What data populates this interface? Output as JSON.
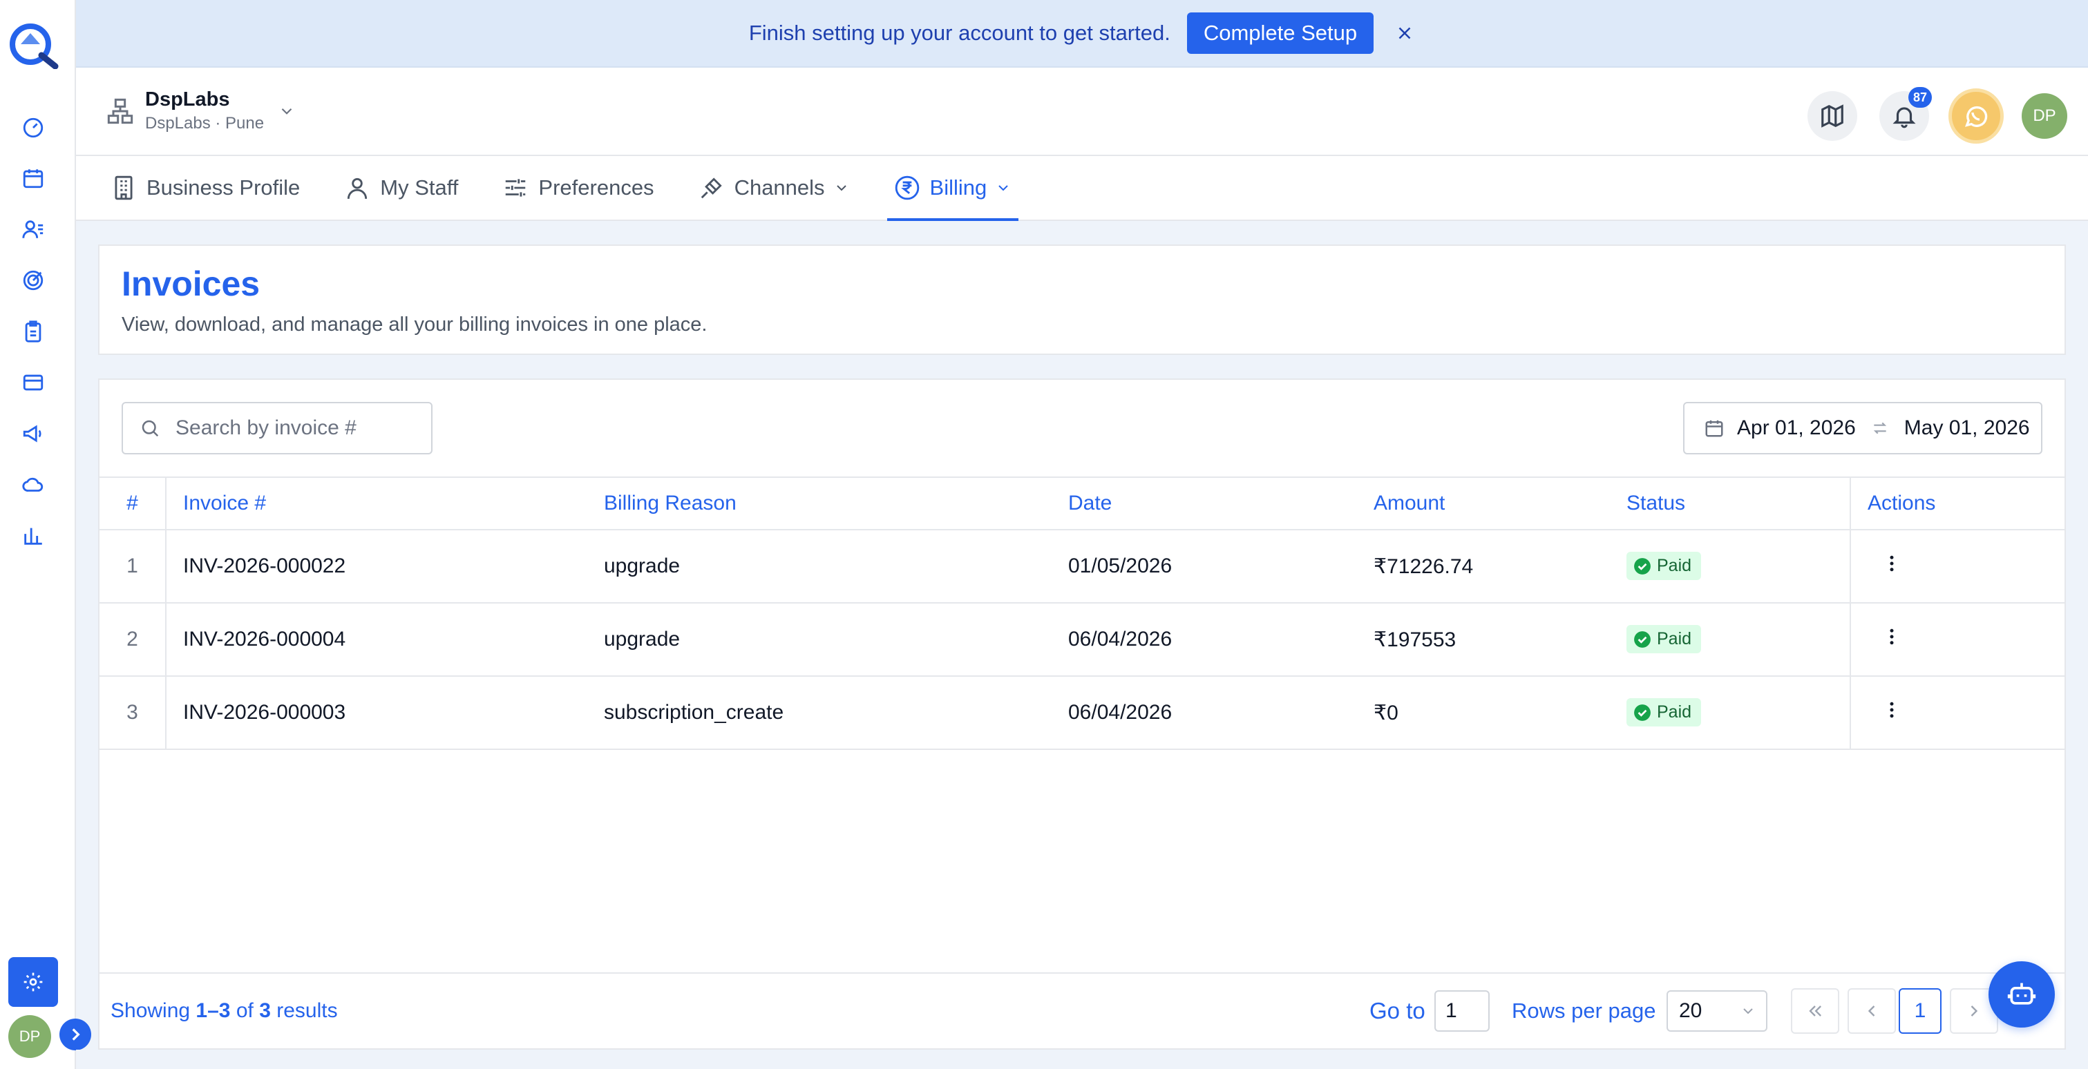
{
  "banner": {
    "message": "Finish setting up your account to get started.",
    "cta_label": "Complete Setup"
  },
  "org": {
    "name": "DspLabs",
    "subtitle": "DspLabs · Pune"
  },
  "header_actions": {
    "notification_count": "87",
    "avatar_initials": "DP"
  },
  "tabs": [
    {
      "label": "Business Profile"
    },
    {
      "label": "My Staff"
    },
    {
      "label": "Preferences"
    },
    {
      "label": "Channels"
    },
    {
      "label": "Billing"
    }
  ],
  "page": {
    "title": "Invoices",
    "subtitle": "View, download, and manage all your billing invoices in one place."
  },
  "search": {
    "placeholder": "Search by invoice #",
    "value": ""
  },
  "date_range": {
    "from": "Apr 01, 2026",
    "to": "May 01, 2026"
  },
  "table": {
    "columns": [
      "#",
      "Invoice #",
      "Billing Reason",
      "Date",
      "Amount",
      "Status",
      "Actions"
    ],
    "rows": [
      {
        "idx": "1",
        "invoice": "INV-2026-000022",
        "reason": "upgrade",
        "date": "01/05/2026",
        "amount": "₹71226.74",
        "status": "Paid"
      },
      {
        "idx": "2",
        "invoice": "INV-2026-000004",
        "reason": "upgrade",
        "date": "06/04/2026",
        "amount": "₹197553",
        "status": "Paid"
      },
      {
        "idx": "3",
        "invoice": "INV-2026-000003",
        "reason": "subscription_create",
        "date": "06/04/2026",
        "amount": "₹0",
        "status": "Paid"
      }
    ]
  },
  "pagination": {
    "showing_prefix": "Showing",
    "showing_range": "1–3",
    "showing_of": "of",
    "showing_total": "3",
    "showing_suffix": "results",
    "goto_label": "Go to",
    "goto_value": "1",
    "rows_per_page_label": "Rows per page",
    "rows_per_page_value": "20",
    "current_page": "1"
  },
  "sidebar": {
    "avatar_initials": "DP",
    "icons": [
      "dashboard-icon",
      "calendar-icon",
      "contacts-icon",
      "target-icon",
      "clipboard-icon",
      "card-icon",
      "megaphone-icon",
      "cloud-icon",
      "bar-chart-icon"
    ]
  },
  "colors": {
    "accent": "#2563eb",
    "banner_bg": "#dde9f9",
    "paid_bg": "#dcfce7",
    "paid_fg": "#166534",
    "avatar_bg": "#84b06b",
    "whatsapp_bg": "#f6c86b"
  }
}
